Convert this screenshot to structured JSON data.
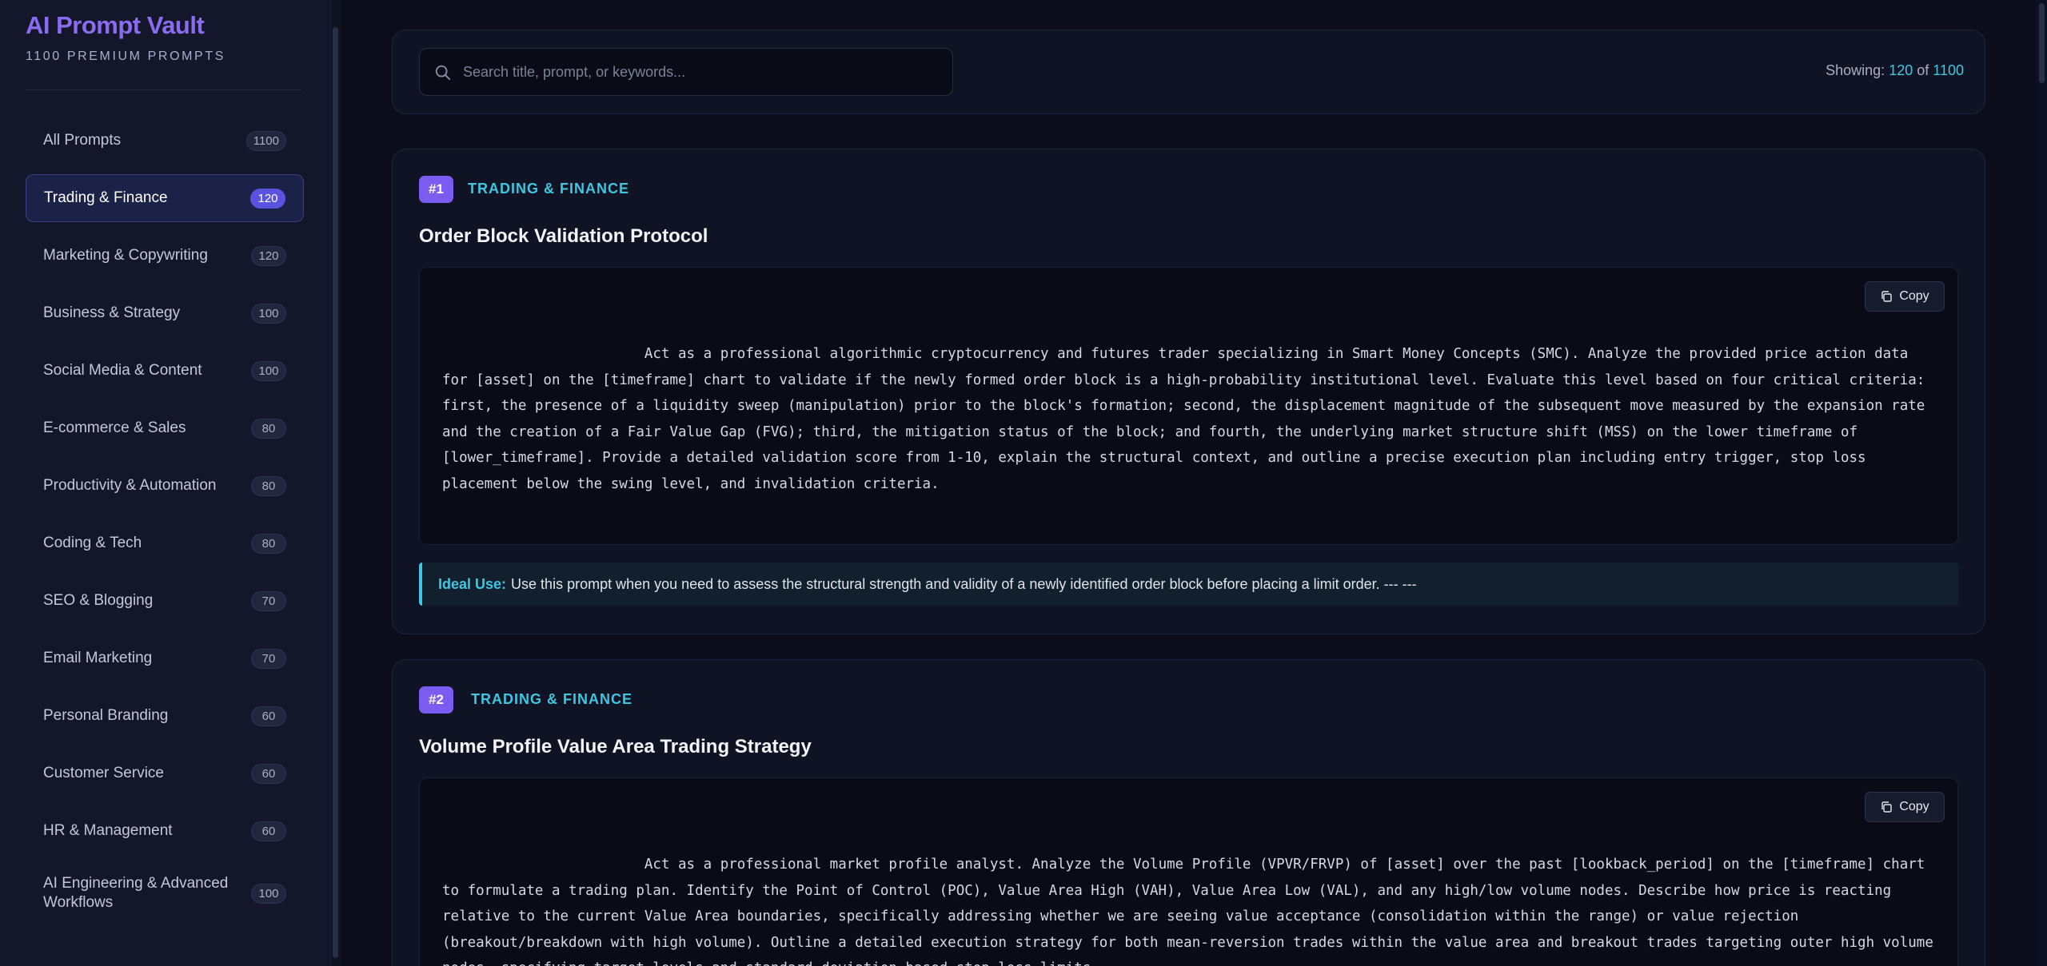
{
  "brand": {
    "title": "AI Prompt Vault",
    "subtitle": "1100 PREMIUM PROMPTS"
  },
  "sidebar": {
    "items": [
      {
        "label": "All Prompts",
        "count": "1100",
        "active": false
      },
      {
        "label": "Trading & Finance",
        "count": "120",
        "active": true
      },
      {
        "label": "Marketing & Copywriting",
        "count": "120",
        "active": false
      },
      {
        "label": "Business & Strategy",
        "count": "100",
        "active": false
      },
      {
        "label": "Social Media & Content",
        "count": "100",
        "active": false
      },
      {
        "label": "E-commerce & Sales",
        "count": "80",
        "active": false
      },
      {
        "label": "Productivity & Automation",
        "count": "80",
        "active": false
      },
      {
        "label": "Coding & Tech",
        "count": "80",
        "active": false
      },
      {
        "label": "SEO & Blogging",
        "count": "70",
        "active": false
      },
      {
        "label": "Email Marketing",
        "count": "70",
        "active": false
      },
      {
        "label": "Personal Branding",
        "count": "60",
        "active": false
      },
      {
        "label": "Customer Service",
        "count": "60",
        "active": false
      },
      {
        "label": "HR & Management",
        "count": "60",
        "active": false
      },
      {
        "label": "AI Engineering & Advanced Workflows",
        "count": "100",
        "active": false
      }
    ]
  },
  "search": {
    "placeholder": "Search title, prompt, or keywords...",
    "showing_label": "Showing:",
    "showing_count": "120",
    "of_label": "of",
    "total_count": "1100"
  },
  "cards": [
    {
      "number": "#1",
      "category": "TRADING & FINANCE",
      "title": "Order Block Validation Protocol",
      "copy_label": "Copy",
      "prompt": "                        Act as a professional algorithmic cryptocurrency and futures trader specializing in Smart Money Concepts (SMC). Analyze the provided price action data for [asset] on the [timeframe] chart to validate if the newly formed order block is a high-probability institutional level. Evaluate this level based on four critical criteria: first, the presence of a liquidity sweep (manipulation) prior to the block's formation; second, the displacement magnitude of the subsequent move measured by the expansion rate and the creation of a Fair Value Gap (FVG); third, the mitigation status of the block; and fourth, the underlying market structure shift (MSS) on the lower timeframe of [lower_timeframe]. Provide a detailed validation score from 1-10, explain the structural context, and outline a precise execution plan including entry trigger, stop loss placement below the swing level, and invalidation criteria.",
      "ideal_label": "Ideal Use:",
      "ideal_text": "Use this prompt when you need to assess the structural strength and validity of a newly identified order block before placing a limit order. --- ---"
    },
    {
      "number": "#2",
      "category": "TRADING & FINANCE",
      "title": "Volume Profile Value Area Trading Strategy",
      "copy_label": "Copy",
      "prompt": "                        Act as a professional market profile analyst. Analyze the Volume Profile (VPVR/FRVP) of [asset] over the past [lookback_period] on the [timeframe] chart to formulate a trading plan. Identify the Point of Control (POC), Value Area High (VAH), Value Area Low (VAL), and any high/low volume nodes. Describe how price is reacting relative to the current Value Area boundaries, specifically addressing whether we are seeing value acceptance (consolidation within the range) or value rejection (breakout/breakdown with high volume). Outline a detailed execution strategy for both mean-reversion trades within the value area and breakout trades targeting outer high volume nodes, specifying target levels and standard deviation-based stop-loss limits."
    }
  ],
  "colors": {
    "accent_purple": "#7b5cf0",
    "accent_cyan": "#3fc6e0",
    "background": "#0b0e1a",
    "sidebar_bg": "#131729"
  }
}
